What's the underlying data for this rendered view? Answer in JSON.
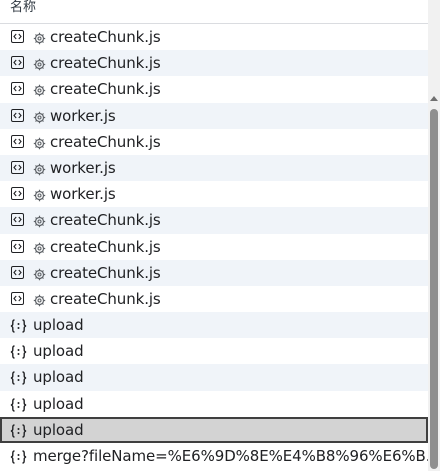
{
  "header": {
    "name_column_label": "名称"
  },
  "requests": [
    {
      "name": "createChunk.js",
      "kind": "script",
      "icon": "file-code-icon",
      "gear": true
    },
    {
      "name": "createChunk.js",
      "kind": "script",
      "icon": "file-code-icon",
      "gear": true
    },
    {
      "name": "createChunk.js",
      "kind": "script",
      "icon": "file-code-icon",
      "gear": true
    },
    {
      "name": "worker.js",
      "kind": "script",
      "icon": "file-code-icon",
      "gear": true
    },
    {
      "name": "createChunk.js",
      "kind": "script",
      "icon": "file-code-icon",
      "gear": true
    },
    {
      "name": "worker.js",
      "kind": "script",
      "icon": "file-code-icon",
      "gear": true
    },
    {
      "name": "worker.js",
      "kind": "script",
      "icon": "file-code-icon",
      "gear": true
    },
    {
      "name": "createChunk.js",
      "kind": "script",
      "icon": "file-code-icon",
      "gear": true
    },
    {
      "name": "createChunk.js",
      "kind": "script",
      "icon": "file-code-icon",
      "gear": true
    },
    {
      "name": "createChunk.js",
      "kind": "script",
      "icon": "file-code-icon",
      "gear": true
    },
    {
      "name": "createChunk.js",
      "kind": "script",
      "icon": "file-code-icon",
      "gear": true
    },
    {
      "name": "upload",
      "kind": "xhr",
      "icon": "json-braces-icon",
      "gear": false
    },
    {
      "name": "upload",
      "kind": "xhr",
      "icon": "json-braces-icon",
      "gear": false
    },
    {
      "name": "upload",
      "kind": "xhr",
      "icon": "json-braces-icon",
      "gear": false
    },
    {
      "name": "upload",
      "kind": "xhr",
      "icon": "json-braces-icon",
      "gear": false
    },
    {
      "name": "upload",
      "kind": "xhr",
      "icon": "json-braces-icon",
      "gear": false,
      "selected": true
    },
    {
      "name": "merge?fileName=%E6%9D%8E%E4%B8%96%E6%B...",
      "kind": "xhr",
      "icon": "json-braces-icon",
      "gear": false
    }
  ],
  "colors": {
    "row_alt": "#f0f4f9",
    "row_selected": "#d3d3d3",
    "text": "#202124",
    "scrollbar_thumb": "#8f8f8f"
  }
}
